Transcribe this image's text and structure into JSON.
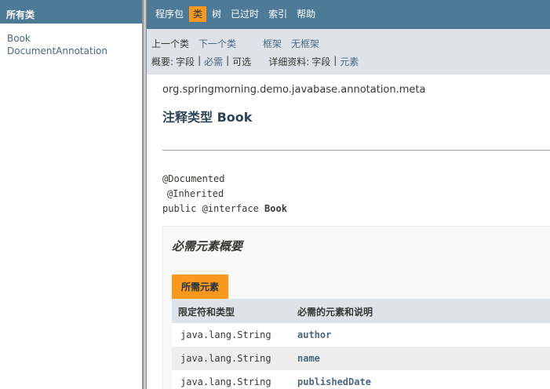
{
  "left": {
    "header": "所有类",
    "classes": [
      "Book",
      "DocumentAnnotation"
    ]
  },
  "topnav": {
    "items": [
      "程序包",
      "类",
      "树",
      "已过时",
      "索引",
      "帮助"
    ],
    "active_index": 1
  },
  "subnav": {
    "prev_class": "上一个类",
    "next_class": "下一个类",
    "frames": "框架",
    "no_frames": "无框架",
    "summary_label": "概要:",
    "summary_field": "字段",
    "summary_required": "必需",
    "summary_optional": "可选",
    "detail_label": "详细资料:",
    "detail_field": "字段",
    "detail_element": "元素",
    "separator": "|"
  },
  "content": {
    "package": "org.springmorning.demo.javabase.annotation.meta",
    "title": "注释类型 Book",
    "signature": {
      "line1": "@Documented",
      "line2": "@Inherited",
      "line3_prefix": "public @interface ",
      "line3_name": "Book"
    },
    "summary": {
      "heading": "必需元素概要",
      "caption": "所需元素",
      "col1": "限定符和类型",
      "col2": "必需的元素和说明",
      "rows": [
        {
          "type": "java.lang.String",
          "name": "author"
        },
        {
          "type": "java.lang.String",
          "name": "name"
        },
        {
          "type": "java.lang.String",
          "name": "publishedDate"
        }
      ]
    }
  },
  "colors": {
    "nav_bg": "#4d7a97",
    "subnav_bg": "#dee3e9",
    "accent": "#f8981d",
    "link": "#4a6782"
  }
}
